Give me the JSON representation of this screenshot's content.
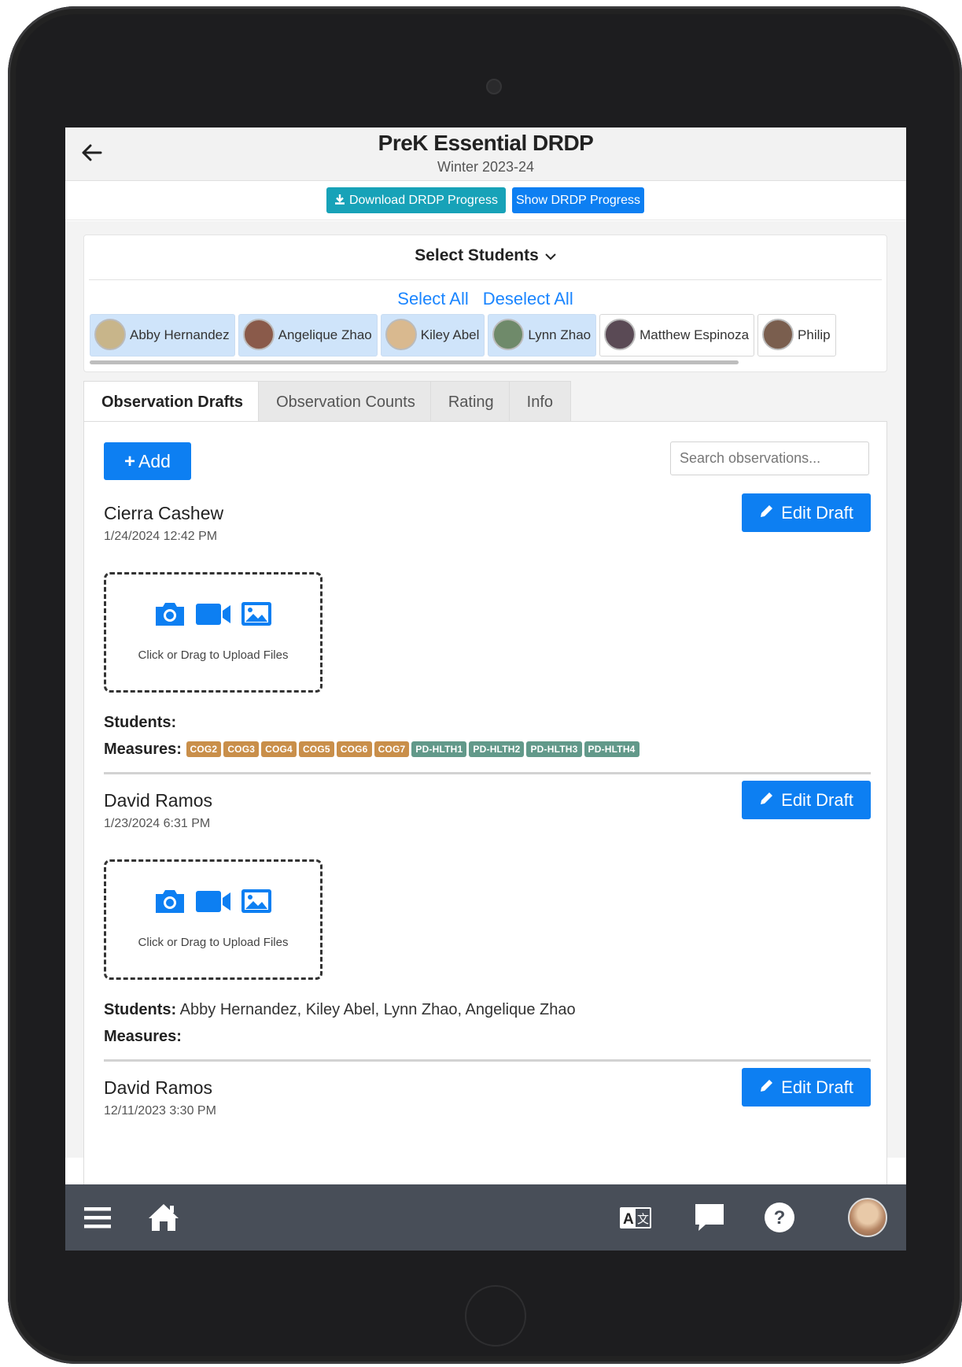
{
  "header": {
    "title": "PreK Essential DRDP",
    "subtitle": "Winter 2023-24"
  },
  "actions": {
    "download_label": "Download DRDP Progress",
    "show_label": "Show DRDP Progress"
  },
  "student_selector": {
    "title": "Select Students",
    "select_all": "Select All",
    "deselect_all": "Deselect All",
    "students": [
      {
        "name": "Abby Hernandez",
        "selected": true,
        "avatar_color": "#c8b58a"
      },
      {
        "name": "Angelique Zhao",
        "selected": true,
        "avatar_color": "#8a5a4a"
      },
      {
        "name": "Kiley Abel",
        "selected": true,
        "avatar_color": "#d9b98f"
      },
      {
        "name": "Lynn Zhao",
        "selected": true,
        "avatar_color": "#6f8a6a"
      },
      {
        "name": "Matthew Espinoza",
        "selected": false,
        "avatar_color": "#5a4a55"
      },
      {
        "name": "Philip",
        "selected": false,
        "avatar_color": "#7a5e4e"
      }
    ]
  },
  "tabs": [
    {
      "label": "Observation Drafts",
      "active": true
    },
    {
      "label": "Observation Counts",
      "active": false
    },
    {
      "label": "Rating",
      "active": false
    },
    {
      "label": "Info",
      "active": false
    }
  ],
  "drafts_panel": {
    "add_label": "Add",
    "search_placeholder": "Search observations...",
    "edit_label": "Edit Draft",
    "upload_text": "Click or Drag to Upload Files",
    "students_label": "Students:",
    "measures_label": "Measures:",
    "observations": [
      {
        "author": "Cierra Cashew",
        "date": "1/24/2024 12:42 PM",
        "students": "",
        "measures": [
          "COG2",
          "COG3",
          "COG4",
          "COG5",
          "COG6",
          "COG7",
          "PD-HLTH1",
          "PD-HLTH2",
          "PD-HLTH3",
          "PD-HLTH4"
        ]
      },
      {
        "author": "David Ramos",
        "date": "1/23/2024 6:31 PM",
        "students": "Abby Hernandez, Kiley Abel, Lynn Zhao, Angelique Zhao",
        "measures": []
      },
      {
        "author": "David Ramos",
        "date": "12/11/2023 3:30 PM",
        "students": "",
        "measures": []
      }
    ]
  },
  "colors": {
    "primary": "#0d7ff2",
    "info": "#17a2b8",
    "cog_badge": "#c98f4a",
    "pd_badge": "#62998a",
    "nav_bar": "#484e58"
  },
  "bottom_nav": {
    "icons": [
      "menu-icon",
      "home-icon",
      "translate-icon",
      "chat-icon",
      "help-icon",
      "user-avatar"
    ]
  }
}
